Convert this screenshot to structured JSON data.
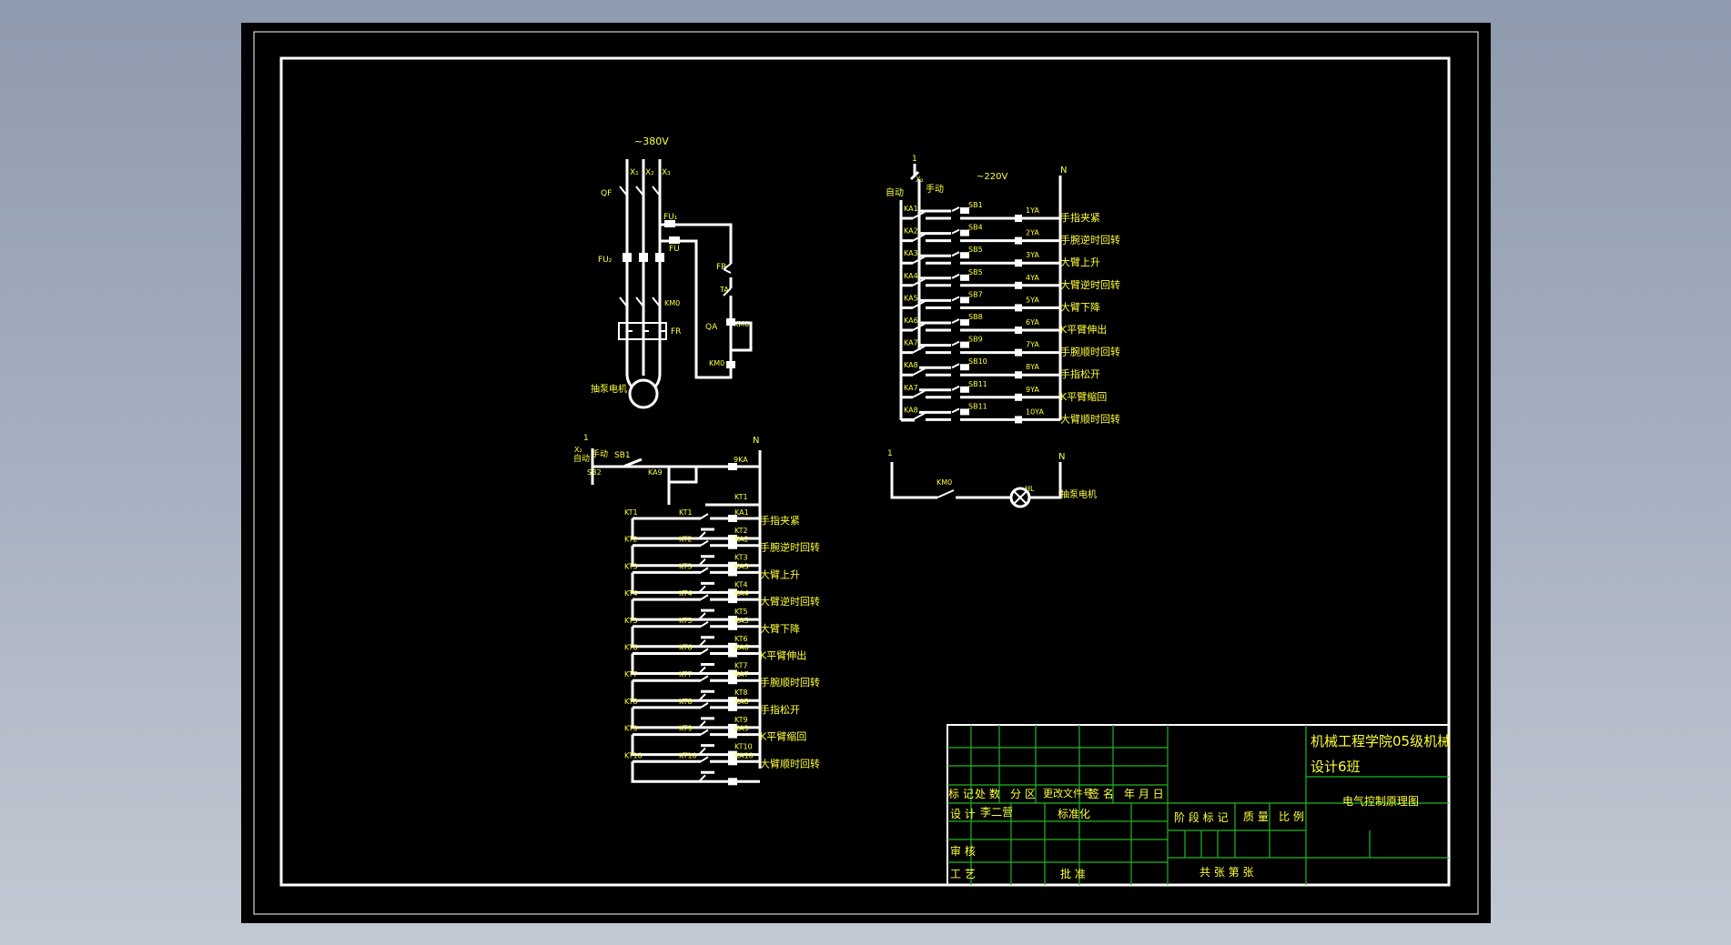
{
  "colors": {
    "background": "#8e9aad",
    "sheet": "#000000",
    "line": "#ffffff",
    "label": "#ffff3a",
    "table_grid": "#1fb81f"
  },
  "power_circuit": {
    "voltage": "~380V",
    "phases": [
      "X₁",
      "X₂",
      "X₃"
    ],
    "breaker": "QF",
    "fuse_main": "FU₂",
    "fuse_ctrl_a": "FU₁",
    "fuse_ctrl_b": "FU",
    "contactor": "KM0",
    "thermal": "FR",
    "motor": "M",
    "motor_label": "抽泵电机",
    "ctrl": {
      "fr": "FR",
      "ta": "TA",
      "qa": "QA",
      "km0_a": "KM0",
      "km0_b": "KM0"
    }
  },
  "valve_circuit": {
    "voltage": "~220V",
    "top_left": "1",
    "top_right": "N",
    "mode_auto": "自动",
    "mode_manual": "手动",
    "switch": "X₂",
    "rows": [
      {
        "ka": "KA1",
        "sb": "SB1",
        "ya": "1YA",
        "name": "手指夹紧"
      },
      {
        "ka": "KA2",
        "sb": "SB4",
        "ya": "2YA",
        "name": "手腕逆时回转"
      },
      {
        "ka": "KA3",
        "sb": "SB5",
        "ya": "3YA",
        "name": "大臂上升"
      },
      {
        "ka": "KA4",
        "sb": "SB5",
        "ya": "4YA",
        "name": "大臂逆时回转"
      },
      {
        "ka": "KA5",
        "sb": "SB7",
        "ya": "5YA",
        "name": "大臂下降"
      },
      {
        "ka": "KA6",
        "sb": "SB8",
        "ya": "6YA",
        "name": "K平臂伸出"
      },
      {
        "ka": "KA7",
        "sb": "SB9",
        "ya": "7YA",
        "name": "手腕顺时回转"
      },
      {
        "ka": "KA8",
        "sb": "SB10",
        "ya": "8YA",
        "name": "手指松开"
      },
      {
        "ka": "KA7",
        "sb": "SB11",
        "ya": "9YA",
        "name": "K平臂缩回"
      },
      {
        "ka": "KA8",
        "sb": "SB11",
        "ya": "10YA",
        "name": "大臂顺时回转"
      }
    ]
  },
  "lamp_circuit": {
    "left": "1",
    "right": "N",
    "contact": "KM0",
    "lamp": "HL",
    "label": "抽泵电机"
  },
  "sequence_circuit": {
    "top_left": "1",
    "top_right": "N",
    "switch": "X₂",
    "mode_auto": "自动",
    "mode_manual": "手动",
    "sb1": "SB1",
    "sb2": "SB2",
    "ka9": "KA9",
    "coil_top": "9KA",
    "kt_first": "KT1",
    "rows": [
      {
        "kt": "KT1",
        "ka": "KA1",
        "next": "KT2",
        "name": "手指夹紧"
      },
      {
        "kt": "KT2",
        "ka": "KA2",
        "next": "KT3",
        "name": "手腕逆时回转"
      },
      {
        "kt": "KT3",
        "ka": "KA3",
        "next": "KT4",
        "name": "大臂上升"
      },
      {
        "kt": "KT4",
        "ka": "KA4",
        "next": "KT5",
        "name": "大臂逆时回转"
      },
      {
        "kt": "KT5",
        "ka": "KA5",
        "next": "KT6",
        "name": "大臂下降"
      },
      {
        "kt": "KT6",
        "ka": "KA6",
        "next": "KT7",
        "name": "K平臂伸出"
      },
      {
        "kt": "KT7",
        "ka": "KA7",
        "next": "KT8",
        "name": "手腕顺时回转"
      },
      {
        "kt": "KT8",
        "ka": "KA8",
        "next": "KT9",
        "name": "手指松开"
      },
      {
        "kt": "KT9",
        "ka": "KA9",
        "next": "KT10",
        "name": "K平臂缩回"
      },
      {
        "kt": "KT10",
        "ka": "KA10",
        "next": "",
        "name": "大臂顺时回转"
      }
    ]
  },
  "title_block": {
    "org": "机械工程学院05级机械",
    "org2": "设计6班",
    "drawing_title": "电气控制原理图",
    "mark": "标 记",
    "count": "处 数",
    "zone": "分 区",
    "doc": "更改文件号",
    "sign": "签 名",
    "date": "年 月 日",
    "design": "设 计",
    "designer": "李二营",
    "std": "标准化",
    "stage": "阶 段 标 记",
    "weight": "质 量",
    "scale": "比 例",
    "review": "审 核",
    "craft": "工 艺",
    "approve": "批 准",
    "sheets": "共  张  第  张"
  }
}
